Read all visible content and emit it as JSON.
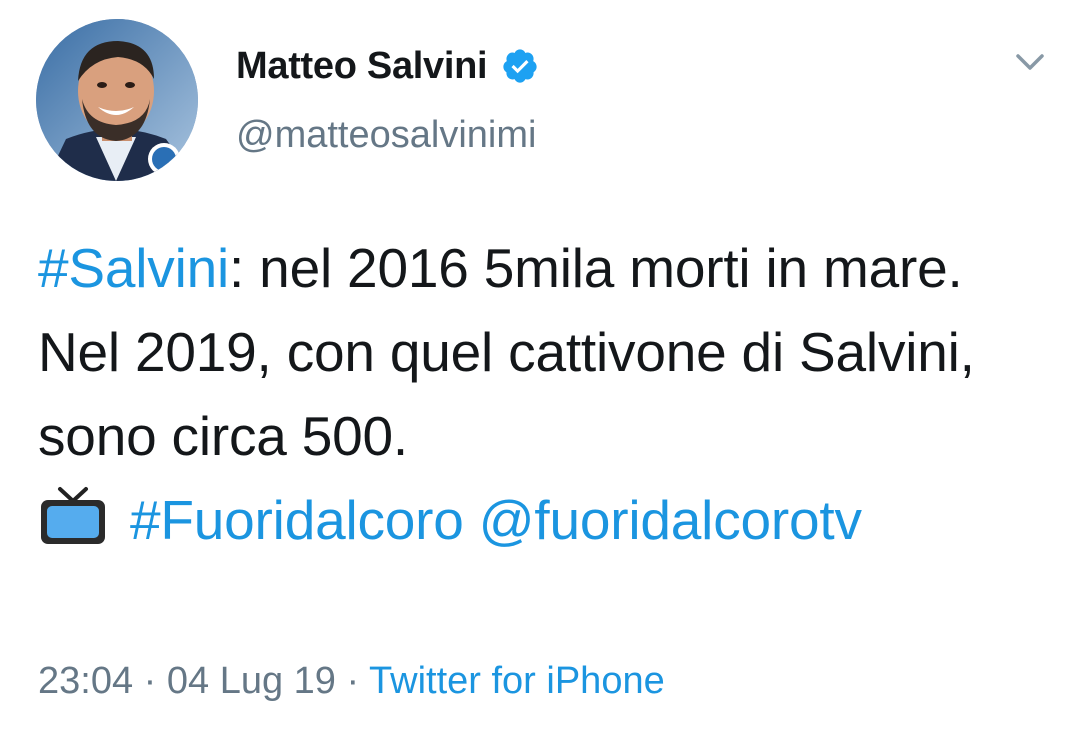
{
  "author": {
    "display_name": "Matteo Salvini",
    "handle": "@matteosalvinimi",
    "verified": true,
    "avatar_icon": "profile-photo"
  },
  "menu_icon": "chevron-down-icon",
  "tweet": {
    "line1_hashtag": "#Salvini",
    "line1_rest": ": nel 2016 5mila morti in mare.",
    "line2": "Nel 2019, con quel cattivone di Salvini, sono circa 500.",
    "emoji_icon": "television-icon",
    "hashtag": "#Fuoridalcoro",
    "mention": "@fuoridalcorotv"
  },
  "meta": {
    "time": "23:04",
    "separator1": " · ",
    "date": "04 Lug 19",
    "separator2": " · ",
    "source": "Twitter for iPhone"
  },
  "colors": {
    "link": "#1b95e0",
    "secondary_text": "#657786",
    "primary_text": "#14171a",
    "verified_badge": "#1da1f2"
  }
}
